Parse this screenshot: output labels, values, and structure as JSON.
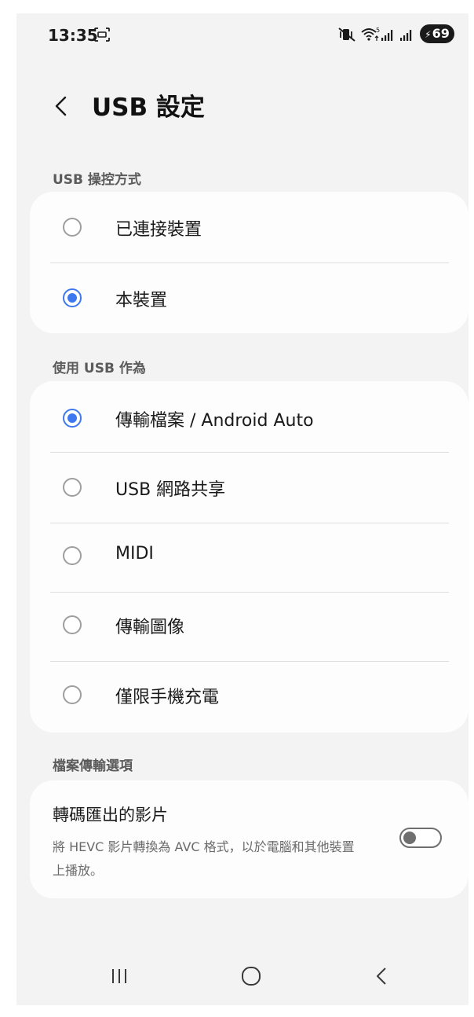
{
  "status_bar": {
    "time": "13:35",
    "battery_level": "69",
    "icons": [
      "screenshot-icon",
      "mute-vibrate-icon",
      "wifi-icon",
      "signal-icon",
      "signal-icon",
      "battery-charging-icon"
    ]
  },
  "header": {
    "back_icon": "chevron-left-icon",
    "title": "USB 設定"
  },
  "usb_controlled_by": {
    "header": "USB 操控方式",
    "options": [
      {
        "label": "已連接裝置",
        "selected": false
      },
      {
        "label": "本裝置",
        "selected": true
      }
    ]
  },
  "use_usb_for": {
    "header": "使用 USB 作為",
    "options": [
      {
        "label": "傳輸檔案 / Android Auto",
        "selected": true
      },
      {
        "label": "USB 網路共享",
        "selected": false
      },
      {
        "label": "MIDI",
        "selected": false
      },
      {
        "label": "傳輸圖像",
        "selected": false
      },
      {
        "label": "僅限手機充電",
        "selected": false
      }
    ]
  },
  "file_transfer_options": {
    "header": "檔案傳輸選項",
    "transcode": {
      "title": "轉碼匯出的影片",
      "description": "將 HEVC 影片轉換為 AVC 格式，以於電腦和其他裝置上播放。",
      "enabled": false
    }
  },
  "nav_bar": {
    "icons": [
      "recents-icon",
      "home-icon",
      "back-icon"
    ]
  },
  "colors": {
    "accent": "#3d78f0",
    "background": "#f3f3f3",
    "card": "#fdfdfd"
  }
}
